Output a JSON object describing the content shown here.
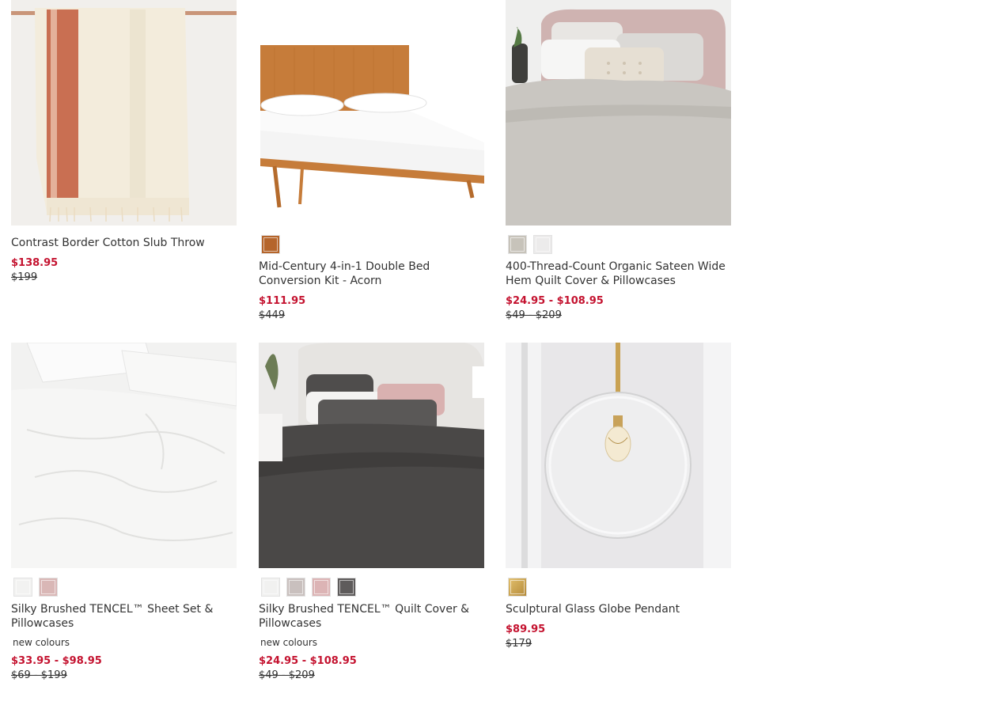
{
  "products": [
    {
      "name": "Contrast Border Cotton Slub Throw",
      "sale_price": "$138.95",
      "regular_price": "$199",
      "swatches": []
    },
    {
      "name": "Mid-Century 4-in-1 Double Bed Conversion Kit - Acorn",
      "sale_price": "$111.95",
      "regular_price": "$449",
      "swatches": [
        "#b5652b"
      ]
    },
    {
      "name": "400-Thread-Count Organic Sateen Wide Hem Quilt Cover & Pillowcases",
      "sale_price": "$24.95 - $108.95",
      "regular_price": "$49 - $209",
      "swatches": [
        "#c7c3ba",
        "#ecebeb"
      ]
    },
    {
      "name": "Silky Brushed TENCEL™ Sheet Set & Pillowcases",
      "badge": "new colours",
      "sale_price": "$33.95 - $98.95",
      "regular_price": "$69 - $199",
      "swatches": [
        "#f2f2f1",
        "#d9b7b6"
      ]
    },
    {
      "name": "Silky Brushed TENCEL™ Quilt Cover & Pillowcases",
      "badge": "new colours",
      "sale_price": "$24.95 - $108.95",
      "regular_price": "$49 - $209",
      "swatches": [
        "#f1f1f0",
        "#c9c0be",
        "#dcb4b5",
        "#5e5b5b"
      ]
    },
    {
      "name": "Sculptural Glass Globe Pendant",
      "sale_price": "$89.95",
      "regular_price": "$179",
      "swatches": [
        "#c9a253"
      ]
    }
  ]
}
